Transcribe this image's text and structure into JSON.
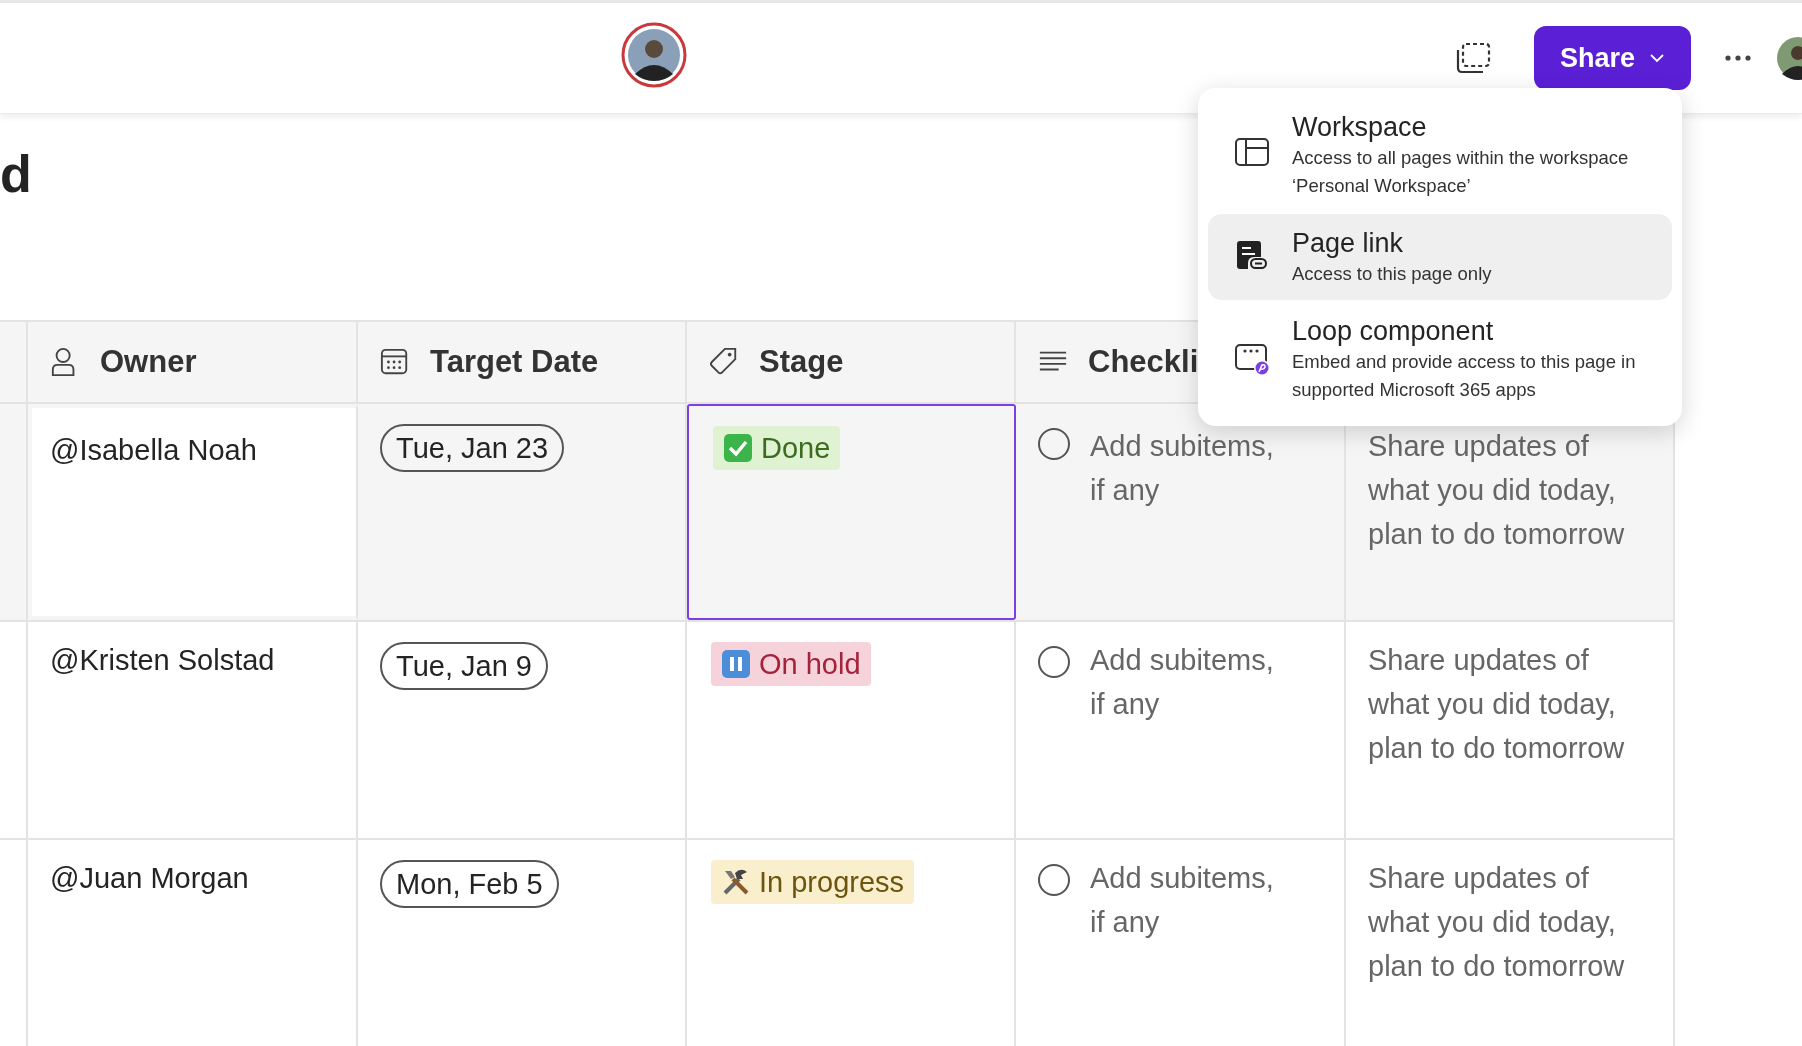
{
  "page_title": "d",
  "toolbar": {
    "share_button": "Share"
  },
  "share_menu": {
    "items": [
      {
        "kind": "workspace",
        "title": "Workspace",
        "description": "Access to all pages within the workspace ‘Personal Workspace’",
        "selected": false
      },
      {
        "kind": "page-link",
        "title": "Page link",
        "description": "Access to this page only",
        "selected": true
      },
      {
        "kind": "loop-component",
        "title": "Loop component",
        "description": "Embed and provide access to this page in supported Microsoft 365 apps",
        "selected": false
      }
    ]
  },
  "table": {
    "columns": [
      {
        "kind": "person",
        "label": "Owner"
      },
      {
        "kind": "date",
        "label": "Target Date"
      },
      {
        "kind": "tag",
        "label": "Stage"
      },
      {
        "kind": "lines",
        "label": "Checkli"
      }
    ],
    "rows": [
      {
        "selected": true,
        "owner": "@Isabella Noah",
        "target_date": "Tue, Jan 23",
        "stage": {
          "kind": "done",
          "label": "Done"
        },
        "checklist": {
          "checked": false,
          "text": "Add subitems, if any"
        },
        "notes": "Share updates of what you did today, plan to do tomorrow"
      },
      {
        "selected": false,
        "owner": "@Kristen Solstad",
        "target_date": "Tue, Jan 9",
        "stage": {
          "kind": "on-hold",
          "label": "On hold"
        },
        "checklist": {
          "checked": false,
          "text": "Add subitems, if any"
        },
        "notes": "Share updates of what you did today, plan to do tomorrow"
      },
      {
        "selected": false,
        "owner": "@Juan Morgan",
        "target_date": "Mon, Feb 5",
        "stage": {
          "kind": "in-progress",
          "label": "In progress"
        },
        "checklist": {
          "checked": false,
          "text": "Add subitems, if any"
        },
        "notes": "Share updates of what you did today, plan to do tomorrow"
      }
    ]
  }
}
